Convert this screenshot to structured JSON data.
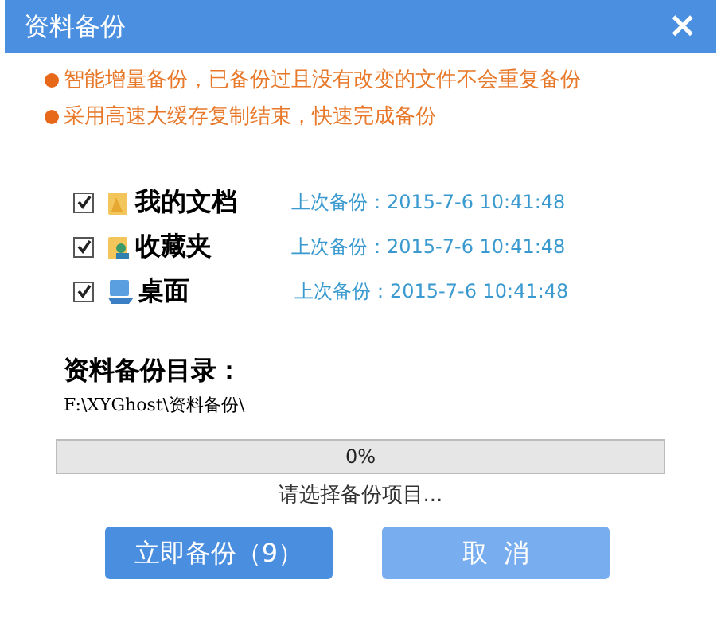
{
  "window": {
    "title": "资料备份",
    "close": "×"
  },
  "tips": [
    "智能增量备份，已备份过且没有改变的文件不会重复备份",
    "采用高速大缓存复制结束，快速完成备份"
  ],
  "items": [
    {
      "label": "我的文档",
      "checked": true,
      "kind": "documents",
      "last_backup": "上次备份：2015-7-6 10:41:48"
    },
    {
      "label": "收藏夹",
      "checked": true,
      "kind": "favorites",
      "last_backup": "上次备份：2015-7-6 10:41:48"
    },
    {
      "label": "桌面",
      "checked": true,
      "kind": "desktop",
      "last_backup": "上次备份：2015-7-6 10:41:48"
    }
  ],
  "directory": {
    "label": "资料备份目录：",
    "path": "F:\\XYGhost\\资料备份\\"
  },
  "progress": {
    "level": 0,
    "text": "0%",
    "status": "请选择备份项目..."
  },
  "buttons": [
    {
      "label": "立即备份（9）",
      "kind": "primary"
    },
    {
      "label": "取  消",
      "kind": "secondary"
    }
  ]
}
